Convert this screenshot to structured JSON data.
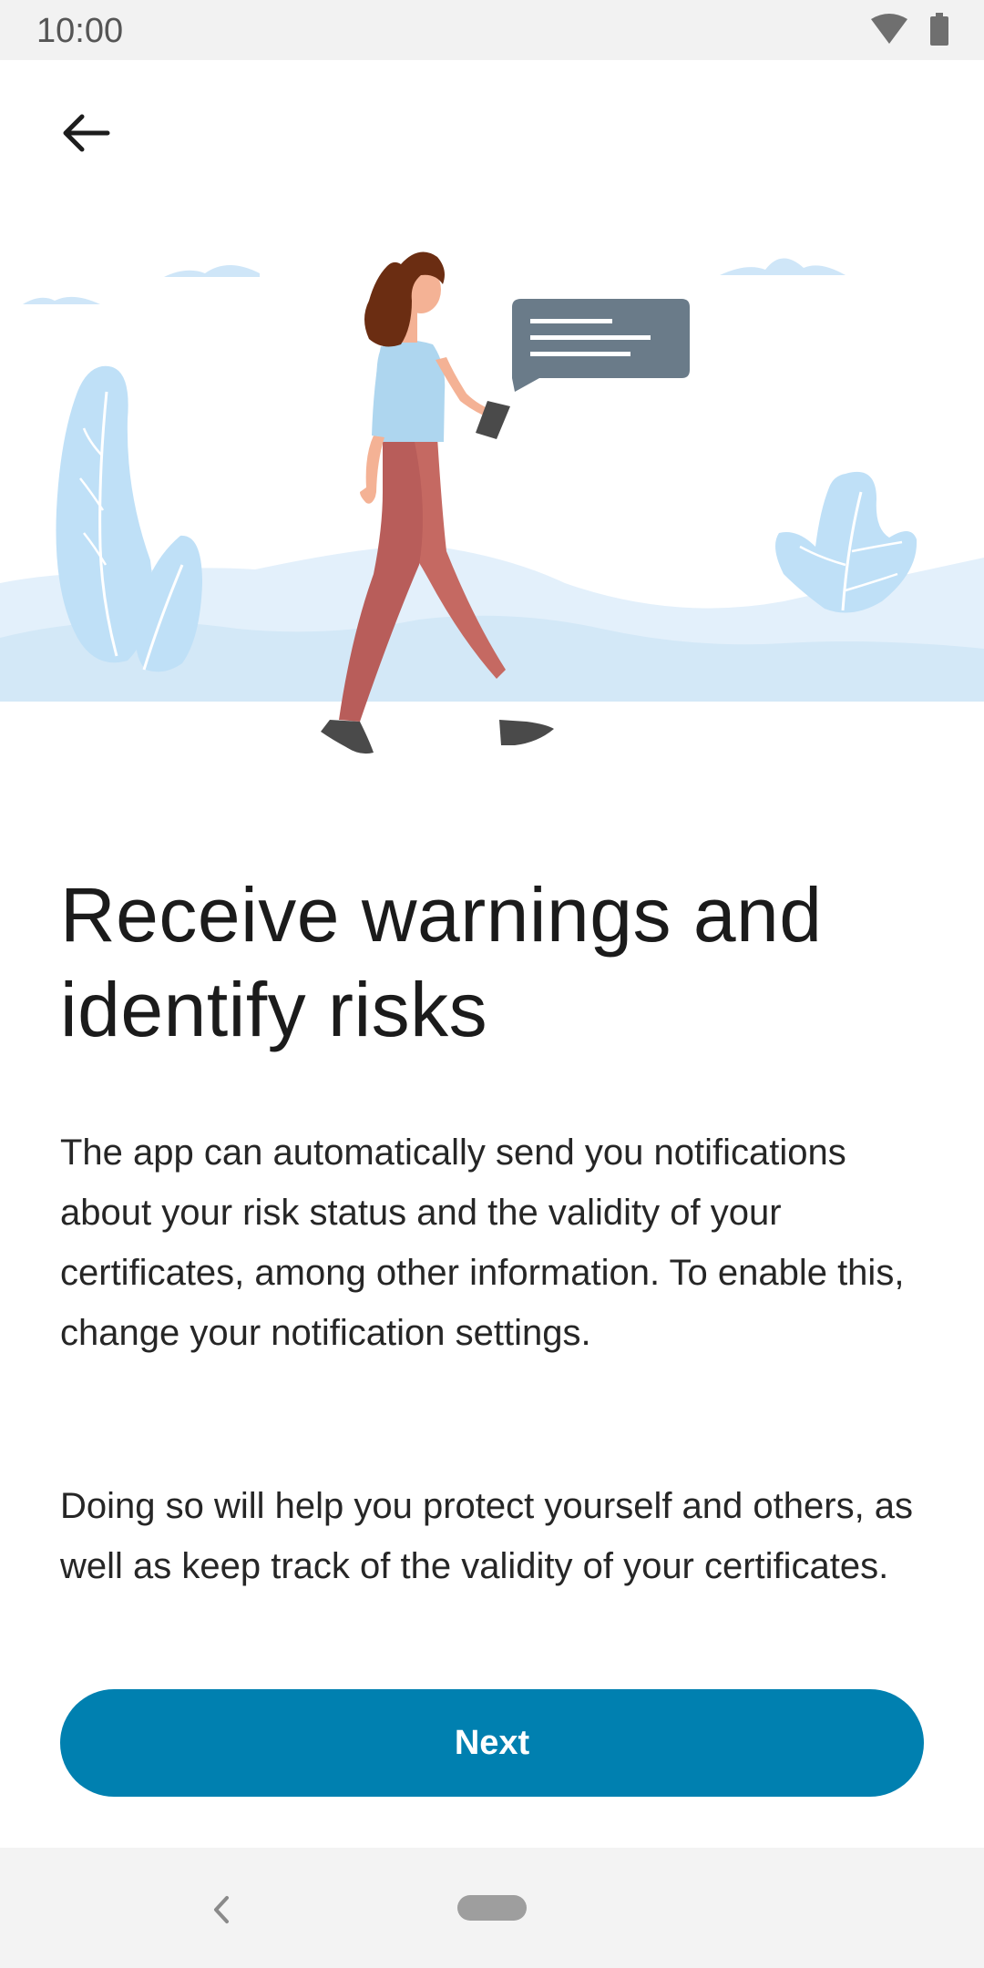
{
  "status_bar": {
    "time": "10:00",
    "icons": [
      "wifi-icon",
      "battery-icon"
    ]
  },
  "header": {
    "back_icon": "arrow-left-icon"
  },
  "illustration": {
    "subject": "woman-walking-with-phone-illustration"
  },
  "main": {
    "title_line1": "Receive warnings and",
    "title_line2": "identify risks",
    "paragraph1": "The app can automatically send you notifications about your risk status and the validity of your certificates, among other information. To enable this, change your notification settings.",
    "paragraph2": "Doing so will help you protect yourself and others, as well as keep track of the validity of your certificates."
  },
  "actions": {
    "next_label": "Next"
  },
  "colors": {
    "accent": "#0080b0",
    "illustration_blue": "#bfe0f7",
    "shirt": "#aed6ef",
    "pants": "#c96a64",
    "hair": "#6b2d12",
    "speech_bubble": "#6a7b89"
  }
}
